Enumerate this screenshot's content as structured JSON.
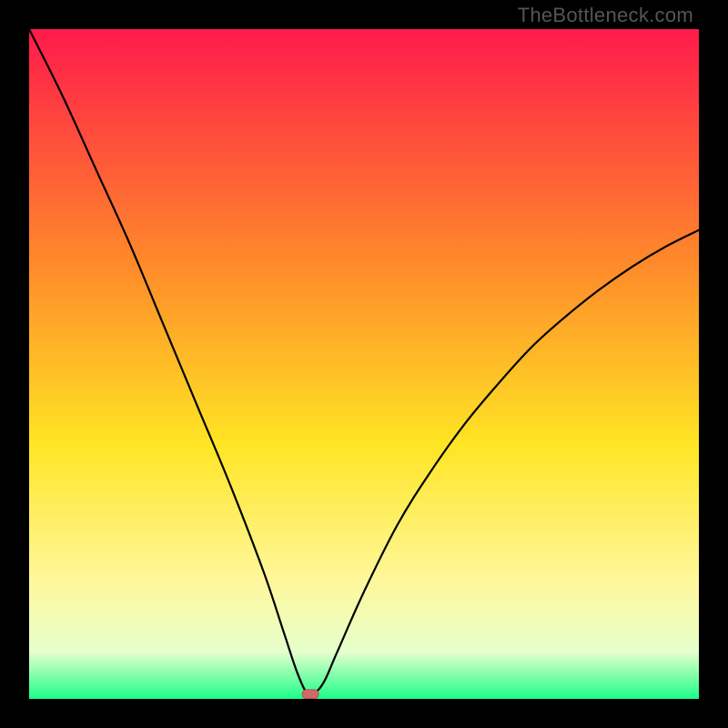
{
  "watermark": "TheBottleneck.com",
  "colors": {
    "frame": "#000000",
    "curve": "#000000",
    "marker_fill": "#cf6a6a",
    "marker_stroke": "#b55454",
    "grad_top": "#ff1a4b",
    "grad_mid1": "#ff8a2a",
    "grad_mid2": "#ffe524",
    "grad_low1": "#fff79a",
    "grad_low2": "#e6ffcc",
    "grad_bottom": "#1dff88"
  },
  "chart_data": {
    "type": "line",
    "title": "",
    "xlabel": "",
    "ylabel": "",
    "xlim": [
      0,
      100
    ],
    "ylim": [
      0,
      100
    ],
    "series": [
      {
        "name": "bottleneck-curve",
        "x": [
          0,
          5,
          10,
          15,
          20,
          25,
          30,
          35,
          38,
          40,
          41.5,
          42.5,
          44,
          46,
          50,
          55,
          60,
          65,
          70,
          75,
          80,
          85,
          90,
          95,
          100
        ],
        "y": [
          100,
          90,
          79,
          68,
          56,
          44,
          32,
          19,
          10,
          4,
          0.8,
          0.8,
          2.5,
          7,
          16,
          26,
          34,
          41,
          47,
          52.5,
          57,
          61,
          64.5,
          67.5,
          70
        ]
      }
    ],
    "marker": {
      "x": 42,
      "y": 0.7,
      "shape": "rounded-rect"
    },
    "background": "vertical-gradient red→orange→yellow→green",
    "grid": false,
    "legend": false
  }
}
